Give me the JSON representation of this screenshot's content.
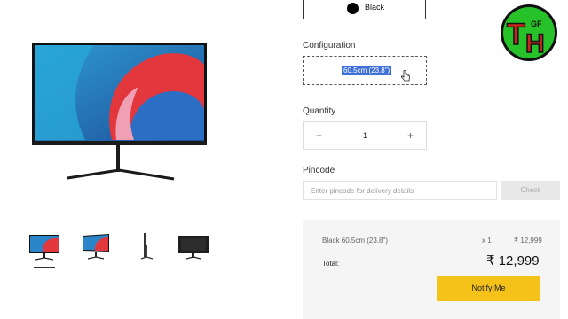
{
  "product": {
    "color_label": "Black",
    "configuration_heading": "Configuration",
    "configuration_value": "60.5cm (23.8\")",
    "quantity_heading": "Quantity",
    "quantity_minus": "−",
    "quantity_value": "1",
    "quantity_plus": "+",
    "pincode_heading": "Pincode",
    "pincode_placeholder": "Enter pincode for delivery details",
    "check_label": "Check"
  },
  "summary": {
    "item": "Black 60.5cm (23.8\")",
    "qty": "x 1",
    "price": "₹ 12,999",
    "total_label": "Total:",
    "total_value": "₹ 12,999",
    "notify_label": "Notify Me"
  },
  "logo": {
    "text": "T H",
    "small_text": "GF"
  },
  "icons": [
    "color-dot-icon",
    "pointer-cursor-icon",
    "minus-icon",
    "plus-icon"
  ],
  "colors": {
    "accent": "#f5c21a",
    "selection": "#3d6fd6",
    "summary_bg": "#f5f5f5",
    "logo_green": "#27c12a",
    "logo_red": "#c9261d"
  }
}
